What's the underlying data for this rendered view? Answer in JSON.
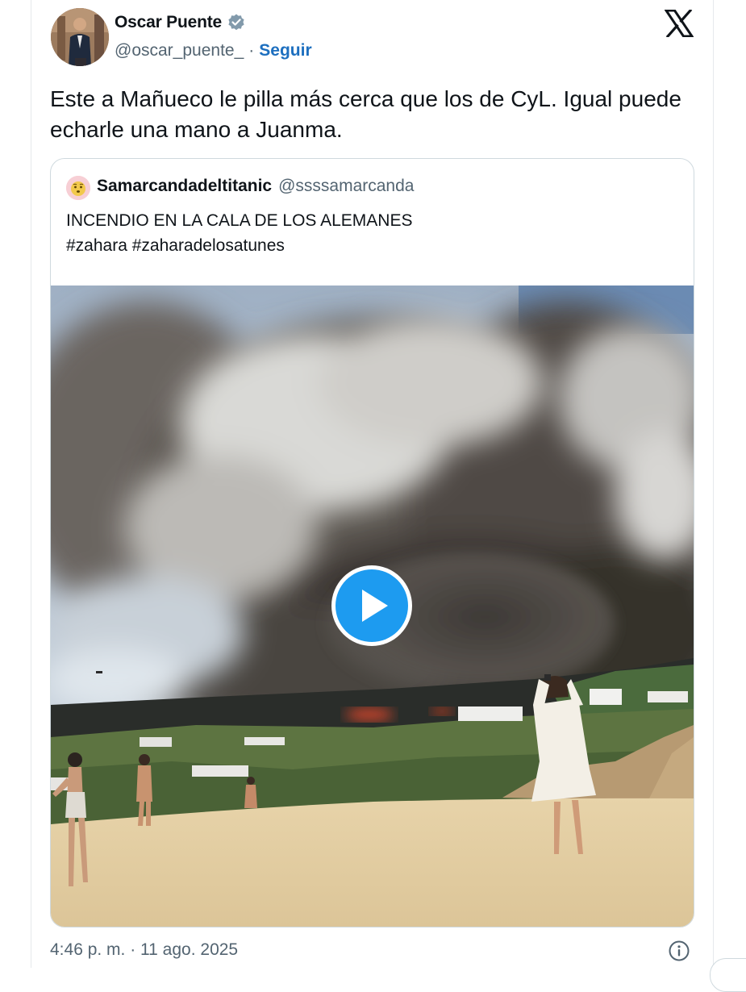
{
  "tweet": {
    "author_name": "Oscar Puente",
    "author_handle": "@oscar_puente_",
    "separator": "·",
    "follow_label": "Seguir",
    "text": "Este a Mañueco le pilla más cerca que los de CyL. Igual puede echarle una mano a Juanma.",
    "timestamp": "4:46 p. m. · 11 ago. 2025",
    "verified": true,
    "icons": {
      "verified": "verified-badge-icon",
      "platform": "x-logo-icon",
      "info": "info-icon"
    }
  },
  "quoted_tweet": {
    "author_name": "Samarcandadeltitanic",
    "author_handle": "@ssssamarcanda",
    "text_line1": "INCENDIO EN LA CALA DE LOS ALEMANES",
    "text_line2": "#zahara #zaharadelosatunes",
    "media": {
      "type": "video",
      "play_icon": "play-icon"
    }
  },
  "colors": {
    "accent": "#1d6fbf",
    "play_button": "#1d9bf0",
    "secondary_text": "#536471",
    "verified": "#829aab"
  }
}
